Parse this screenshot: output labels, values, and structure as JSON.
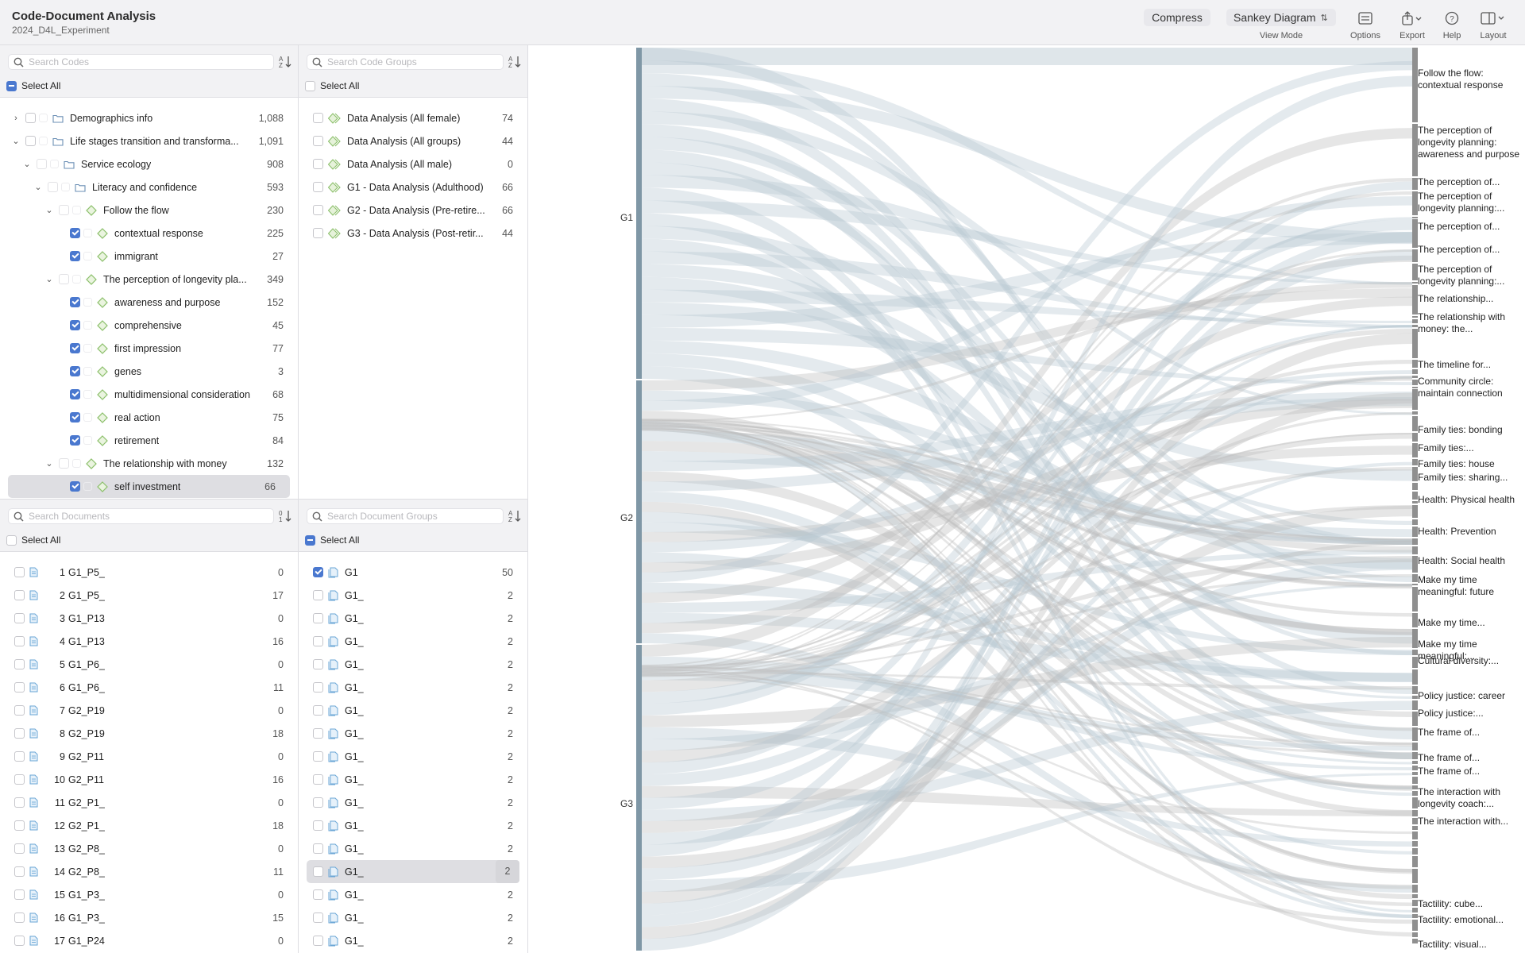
{
  "header": {
    "title": "Code-Document Analysis",
    "subtitle": "2024_D4L_Experiment",
    "compress_label": "Compress",
    "view_mode_value": "Sankey Diagram",
    "view_mode_caption": "View Mode",
    "options_label": "Options",
    "export_label": "Export",
    "help_label": "Help",
    "layout_label": "Layout"
  },
  "codes_panel": {
    "search_placeholder": "Search Codes",
    "select_all_label": "Select All",
    "rows": [
      {
        "label": "Demographics info",
        "count": "1,088"
      },
      {
        "label": "Life stages transition and transforma...",
        "count": "1,091"
      },
      {
        "label": "Service ecology",
        "count": "908"
      },
      {
        "label": "Literacy and confidence",
        "count": "593"
      },
      {
        "label": "Follow the flow",
        "count": "230"
      },
      {
        "label": "contextual response",
        "count": "225"
      },
      {
        "label": "immigrant",
        "count": "27"
      },
      {
        "label": "The perception of longevity pla...",
        "count": "349"
      },
      {
        "label": "awareness and purpose",
        "count": "152"
      },
      {
        "label": "comprehensive",
        "count": "45"
      },
      {
        "label": "first impression",
        "count": "77"
      },
      {
        "label": "genes",
        "count": "3"
      },
      {
        "label": "multidimensional consideration",
        "count": "68"
      },
      {
        "label": "real action",
        "count": "75"
      },
      {
        "label": "retirement",
        "count": "84"
      },
      {
        "label": "The relationship with money",
        "count": "132"
      },
      {
        "label": "self investment",
        "count": "66"
      }
    ]
  },
  "code_groups_panel": {
    "search_placeholder": "Search Code Groups",
    "select_all_label": "Select All",
    "rows": [
      {
        "label": "Data Analysis (All female)",
        "count": "74"
      },
      {
        "label": "Data Analysis (All groups)",
        "count": "44"
      },
      {
        "label": "Data Analysis (All male)",
        "count": "0"
      },
      {
        "label": "G1 - Data Analysis (Adulthood)",
        "count": "66"
      },
      {
        "label": "G2 - Data Analysis (Pre-retire...",
        "count": "66"
      },
      {
        "label": "G3 - Data Analysis (Post-retir...",
        "count": "44"
      }
    ]
  },
  "documents_panel": {
    "search_placeholder": "Search Documents",
    "select_all_label": "Select All",
    "rows": [
      {
        "num": "1",
        "label": "G1_P5_",
        "count": "0"
      },
      {
        "num": "2",
        "label": "G1_P5_",
        "count": "17"
      },
      {
        "num": "3",
        "label": "G1_P13",
        "count": "0"
      },
      {
        "num": "4",
        "label": "G1_P13",
        "count": "16"
      },
      {
        "num": "5",
        "label": "G1_P6_",
        "count": "0"
      },
      {
        "num": "6",
        "label": "G1_P6_",
        "count": "11"
      },
      {
        "num": "7",
        "label": "G2_P19",
        "count": "0"
      },
      {
        "num": "8",
        "label": "G2_P19",
        "count": "18"
      },
      {
        "num": "9",
        "label": "G2_P11",
        "count": "0"
      },
      {
        "num": "10",
        "label": "G2_P11",
        "count": "16"
      },
      {
        "num": "11",
        "label": "G2_P1_",
        "count": "0"
      },
      {
        "num": "12",
        "label": "G2_P1_",
        "count": "18"
      },
      {
        "num": "13",
        "label": "G2_P8_",
        "count": "0"
      },
      {
        "num": "14",
        "label": "G2_P8_",
        "count": "11"
      },
      {
        "num": "15",
        "label": "G1_P3_",
        "count": "0"
      },
      {
        "num": "16",
        "label": "G1_P3_",
        "count": "15"
      },
      {
        "num": "17",
        "label": "G1_P24",
        "count": "0"
      }
    ]
  },
  "document_groups_panel": {
    "search_placeholder": "Search Document Groups",
    "select_all_label": "Select All",
    "rows": [
      {
        "label": "G1",
        "count": "50"
      },
      {
        "label": "G1_",
        "count": "2"
      },
      {
        "label": "G1_",
        "count": "2"
      },
      {
        "label": "G1_",
        "count": "2"
      },
      {
        "label": "G1_",
        "count": "2"
      },
      {
        "label": "G1_",
        "count": "2"
      },
      {
        "label": "G1_",
        "count": "2"
      },
      {
        "label": "G1_",
        "count": "2"
      },
      {
        "label": "G1_",
        "count": "2"
      },
      {
        "label": "G1_",
        "count": "2"
      },
      {
        "label": "G1_",
        "count": "2"
      },
      {
        "label": "G1_",
        "count": "2"
      },
      {
        "label": "G1_",
        "count": "2"
      },
      {
        "label": "G1_",
        "count": "2"
      },
      {
        "label": "G1_",
        "count": "2"
      },
      {
        "label": "G1_",
        "count": "2"
      },
      {
        "label": "G1_",
        "count": "2"
      }
    ]
  },
  "sankey": {
    "sources": [
      "G1",
      "G2",
      "G3"
    ],
    "targets": [
      "Follow the flow: contextual response",
      "The perception of longevity planning: awareness and purpose",
      "The perception of...",
      "The perception of longevity planning:...",
      "The perception of...",
      "The perception of...",
      "The perception of longevity planning:...",
      "The relationship...",
      "The relationship with money: the...",
      "The timeline for...",
      "Community circle: maintain connection",
      "Family ties: bonding",
      "Family ties:...",
      "Family ties: house",
      "Family ties: sharing...",
      "Health: Physical health",
      "Health: Prevention",
      "Health: Social health",
      "Make my time meaningful: future",
      "Make my time...",
      "Make my time meaningful:...",
      "Cultural diversity:...",
      "Policy justice: career",
      "Policy justice:...",
      "The frame of...",
      "The frame of...",
      "The frame of...",
      "The interaction with longevity coach:...",
      "The interaction with...",
      "Tactility: cube...",
      "Tactility: emotional...",
      "Tactility: visual..."
    ]
  },
  "colors": {
    "accent": "#4a78cf",
    "source_bar": "#7f97a6",
    "target_bar": "#8f8f8f",
    "flow_blue": "#b7c7d1",
    "flow_grey": "#bdbdbd"
  }
}
